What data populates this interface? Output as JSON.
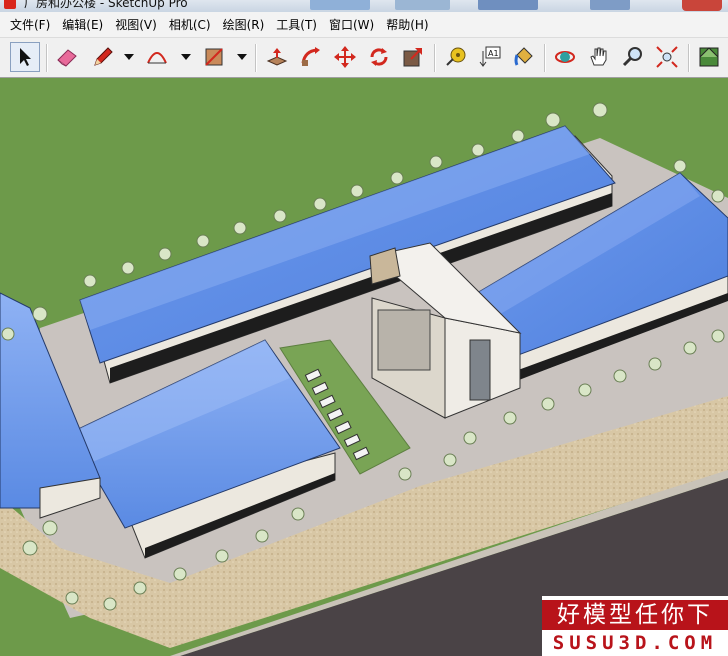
{
  "window": {
    "title": "厂房和办公楼 - SketchUp Pro"
  },
  "menu": [
    {
      "label": "文件(F)"
    },
    {
      "label": "编辑(E)"
    },
    {
      "label": "视图(V)"
    },
    {
      "label": "相机(C)"
    },
    {
      "label": "绘图(R)"
    },
    {
      "label": "工具(T)"
    },
    {
      "label": "窗口(W)"
    },
    {
      "label": "帮助(H)"
    }
  ],
  "toolbar": {
    "tools": [
      {
        "icon": "select-arrow-icon",
        "active": true
      },
      {
        "icon": "eraser-icon"
      },
      {
        "icon": "pencil-icon",
        "dropdown": true
      },
      {
        "icon": "arc-icon",
        "dropdown": true
      },
      {
        "icon": "rectangle-icon",
        "dropdown": true
      },
      {
        "icon": "push-pull-icon"
      },
      {
        "icon": "follow-me-icon"
      },
      {
        "icon": "move-icon"
      },
      {
        "icon": "rotate-icon"
      },
      {
        "icon": "scale-icon"
      },
      {
        "icon": "tape-measure-icon"
      },
      {
        "icon": "text-label-icon"
      },
      {
        "icon": "paint-bucket-icon"
      },
      {
        "icon": "orbit-icon"
      },
      {
        "icon": "pan-icon"
      },
      {
        "icon": "zoom-icon"
      },
      {
        "icon": "zoom-extents-icon"
      },
      {
        "icon": "components-icon"
      }
    ],
    "text_tool_label": "A1"
  },
  "colors": {
    "grass": "#6d9a4a",
    "road": "#4a4346",
    "roof": "#5f8fe8",
    "accent": "#b8131a"
  },
  "watermark": {
    "line1": "好模型任你下",
    "line2": "SUSU3D.COM"
  }
}
